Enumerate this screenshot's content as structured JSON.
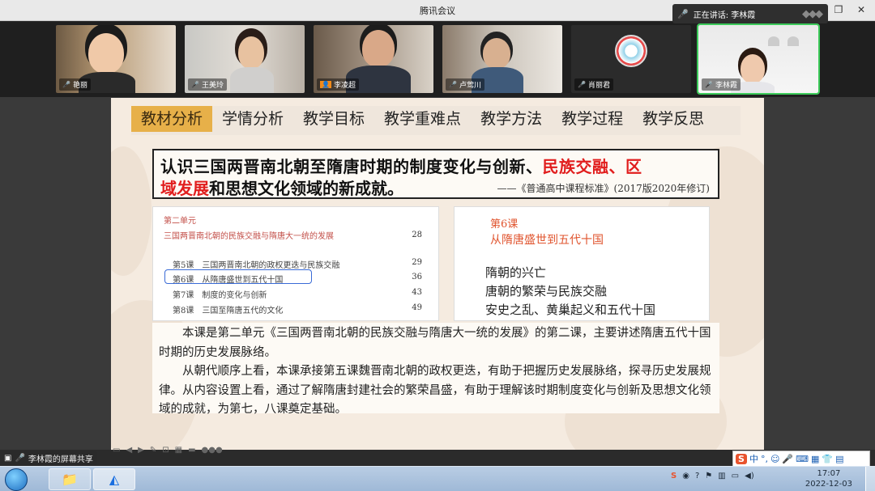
{
  "window": {
    "title": "腾讯会议",
    "speaking_label": "正在讲话: 李林霞"
  },
  "participants": [
    {
      "name": "艳丽",
      "muted": false
    },
    {
      "name": "王美玲",
      "muted": false
    },
    {
      "name": "李凌超",
      "muted": false
    },
    {
      "name": "卢莺川",
      "muted": false
    },
    {
      "name": "肖丽君",
      "muted": false
    },
    {
      "name": "李林霞",
      "muted": false
    }
  ],
  "slide": {
    "tabs": [
      "教材分析",
      "学情分析",
      "教学目标",
      "教学重难点",
      "教学方法",
      "教学过程",
      "教学反思"
    ],
    "active_tab": 0,
    "standard": {
      "line1_a": "认识三国两晋南北朝至隋唐时期的制度变化与创新、",
      "line1_red": "民族交融、区",
      "line2_red": "域发展",
      "line2_b": "和思想文化领域的新成就。",
      "source": "——《普通高中课程标准》(2017版2020年修订)"
    },
    "toc": {
      "unit": "第二单元",
      "unit_title": "三国两晋南北朝的民族交融与隋唐大一统的发展",
      "unit_page": "28",
      "rows": [
        {
          "label": "第5课　三国两晋南北朝的政权更迭与民族交融",
          "page": "29"
        },
        {
          "label": "第6课　从隋唐盛世到五代十国",
          "page": "36"
        },
        {
          "label": "第7课　制度的变化与创新",
          "page": "43"
        },
        {
          "label": "第8课　三国至隋唐五代的文化",
          "page": "49"
        }
      ]
    },
    "lesson": {
      "number": "第6课",
      "title": "从隋唐盛世到五代十国",
      "items": [
        "隋朝的兴亡",
        "唐朝的繁荣与民族交融",
        "安史之乱、黄巢起义和五代十国"
      ]
    },
    "description": [
      "本课是第二单元《三国两晋南北朝的民族交融与隋唐大一统的发展》的第二课，主要讲述隋唐五代十国时期的历史发展脉络。",
      "从朝代顺序上看，本课承接第五课魏晋南北朝的政权更迭，有助于把握历史发展脉络，探寻历史发展规律。从内容设置上看，通过了解隋唐封建社会的繁荣昌盛，有助于理解该时期制度变化与创新及思想文化领域的成就，为第七，八课奠定基础。"
    ]
  },
  "share_banner": "李林霞的屏幕共享",
  "ime": {
    "logo": "S",
    "mode": "中"
  },
  "taskbar": {
    "time": "17:07",
    "date": "2022-12-03"
  }
}
